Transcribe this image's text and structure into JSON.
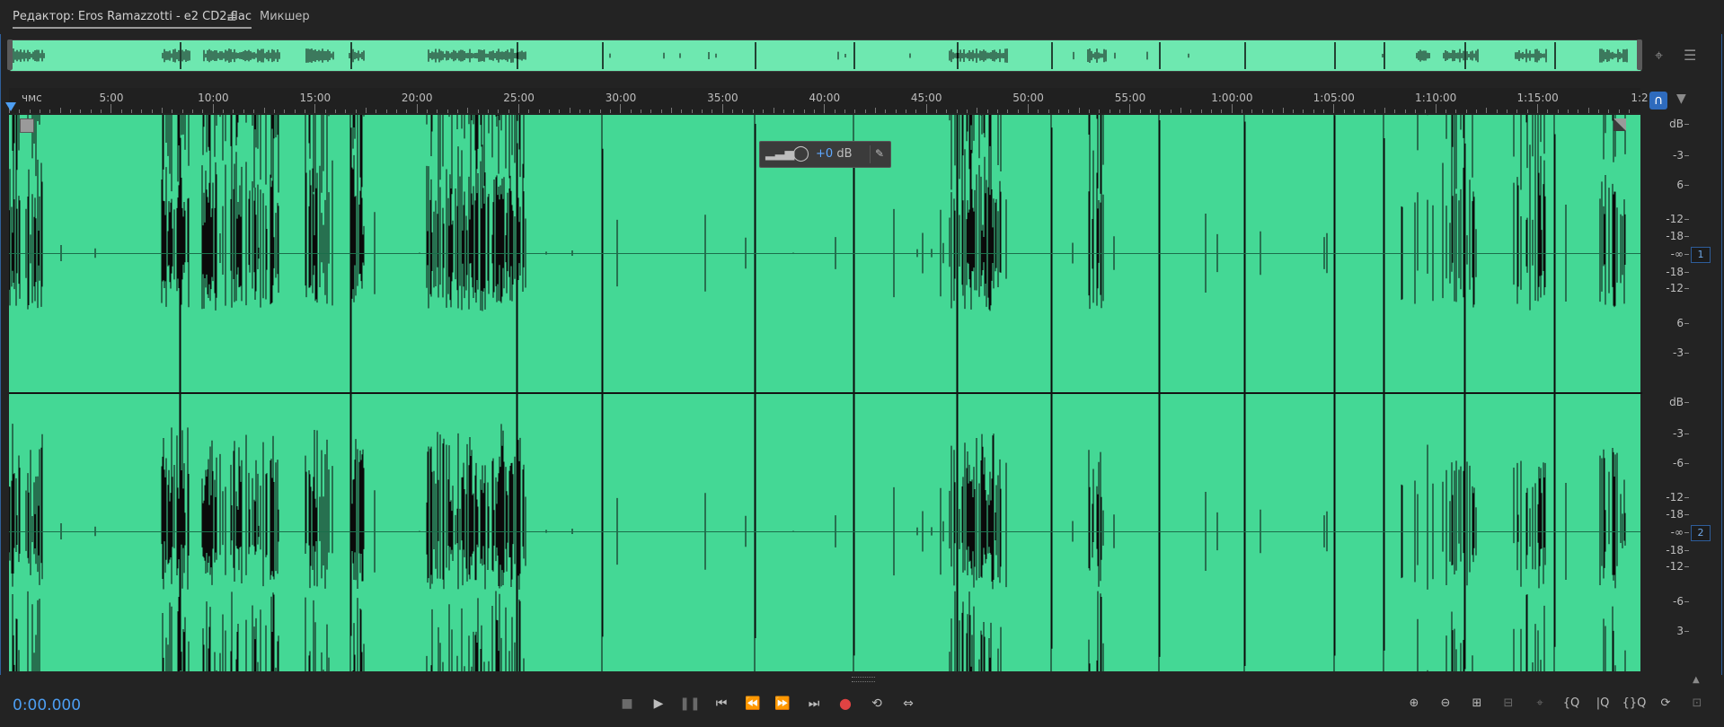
{
  "tabs": {
    "editor_label": "Редактор: Eros Ramazzotti - e2 CD2.flac",
    "editor_menu_icon": "≡",
    "mixer_label": "Микшер"
  },
  "ruler": {
    "unit_label": "чмс",
    "labels": [
      "5:00",
      "10:00",
      "15:00",
      "20:00",
      "25:00",
      "30:00",
      "35:00",
      "40:00",
      "45:00",
      "50:00",
      "55:00",
      "1:00:00",
      "1:05:00",
      "1:10:00",
      "1:15:00",
      "1:2"
    ]
  },
  "hud": {
    "gain_value": "+0",
    "gain_unit": "dB"
  },
  "db_scale": {
    "channel1": [
      "dB",
      "-3",
      "6",
      "-12",
      "-18",
      "-∞",
      "-18",
      "-12",
      "6",
      "-3"
    ],
    "channel2": [
      "dB",
      "-3",
      "-6",
      "-12",
      "-18",
      "-∞",
      "-18",
      "-12",
      "-6",
      "3"
    ]
  },
  "channels": [
    "1",
    "2"
  ],
  "transport": {
    "time": "0:00.000",
    "buttons": [
      "stop",
      "play",
      "pause",
      "go-to-start",
      "rewind",
      "fast-forward",
      "go-to-end",
      "record",
      "loop",
      "skip-selection"
    ]
  },
  "zoom": {
    "buttons": [
      "zoom-in-amplitude",
      "zoom-out-amplitude",
      "zoom-in-time",
      "zoom-out-time",
      "zoom-out-full",
      "zoom-to-selection",
      "zoom-in-left",
      "zoom-in-right",
      "zoom-selection",
      "zoom-reset"
    ]
  },
  "colors": {
    "waveform": "#44d895",
    "accent": "#4d9ef2",
    "record": "#e04343"
  }
}
